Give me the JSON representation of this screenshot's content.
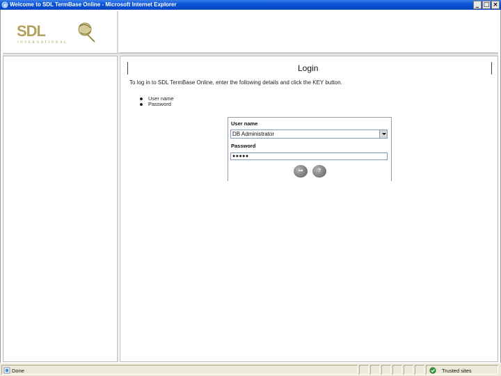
{
  "window": {
    "title": "Welcome to SDL TermBase Online - Microsoft Internet Explorer",
    "buttons": {
      "minimize": "_",
      "maximize": "□",
      "close": "×"
    }
  },
  "logo": {
    "brand": "SDL",
    "tagline": "INTERNATIONAL"
  },
  "page": {
    "title": "Login",
    "intro": "To log in to SDL TermBase Online, enter the following details and click the KEY button.",
    "bullets": [
      "User name",
      "Password"
    ]
  },
  "login": {
    "username_label": "User name",
    "username_value": "DB Administrator",
    "password_label": "Password",
    "password_value": "●●●●●",
    "key_button": "⊶",
    "help_button": "?"
  },
  "statusbar": {
    "status": "Done",
    "zone": "Trusted sites"
  },
  "colors": {
    "titlebar": "#0a56d6",
    "logo_gold": "#b3a25c",
    "button_grey": "#7e7e7e",
    "statusbar_bg": "#ece9d8"
  }
}
